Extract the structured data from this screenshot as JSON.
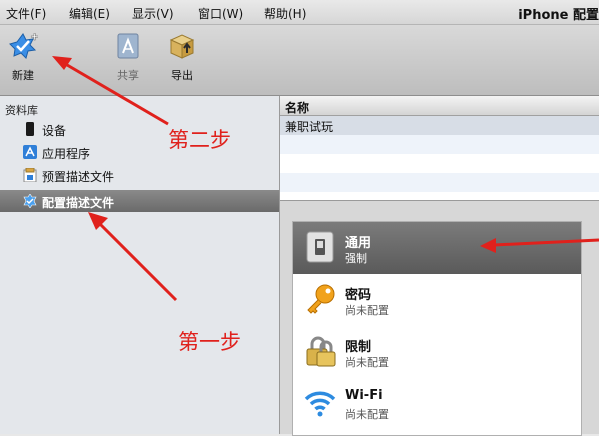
{
  "menubar": {
    "items": [
      "文件(F)",
      "编辑(E)",
      "显示(V)",
      "窗口(W)",
      "帮助(H)"
    ],
    "app_title": "iPhone 配置"
  },
  "toolbar": {
    "new_label": "新建",
    "share_label": "共享",
    "export_label": "导出"
  },
  "sidebar": {
    "header": "资料库",
    "items": [
      {
        "label": "设备",
        "icon": "device-icon"
      },
      {
        "label": "应用程序",
        "icon": "app-store-icon"
      },
      {
        "label": "预置描述文件",
        "icon": "provisioning-profile-icon"
      },
      {
        "label": "配置描述文件",
        "icon": "configuration-profile-icon",
        "selected": true
      }
    ]
  },
  "table": {
    "column_name": "名称",
    "rows": [
      "兼职试玩"
    ]
  },
  "payloads": [
    {
      "title": "通用",
      "status": "强制",
      "icon": "general-switch-icon",
      "selected": true
    },
    {
      "title": "密码",
      "status": "尚未配置",
      "icon": "key-icon"
    },
    {
      "title": "限制",
      "status": "尚未配置",
      "icon": "padlock-icon"
    },
    {
      "title": "Wi-Fi",
      "status": "尚未配置",
      "icon": "wifi-icon"
    }
  ],
  "annotations": {
    "step2": "第二步",
    "step1": "第一步"
  },
  "colors": {
    "annotation_red": "#e0211c",
    "selection_gray": "#6a6a6a"
  }
}
